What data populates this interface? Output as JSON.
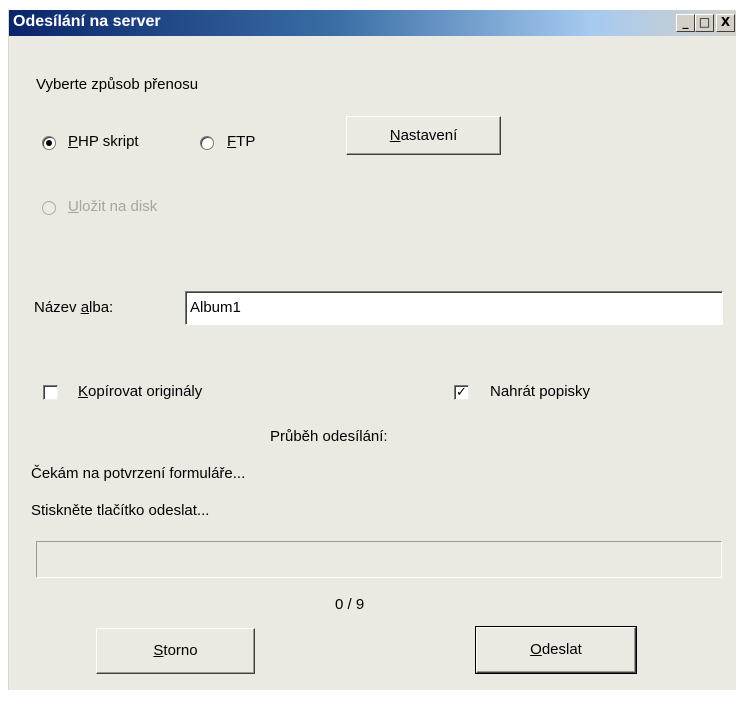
{
  "window": {
    "title": "Odesílání na server",
    "controls": {
      "minimize": "_",
      "maximize": "□",
      "close": "X"
    }
  },
  "transfer": {
    "heading": "Vyberte způsob přenosu",
    "php": {
      "mnemonic": "P",
      "rest": "HP skript",
      "checked": true
    },
    "ftp": {
      "mnemonic": "F",
      "rest": "TP",
      "checked": false
    },
    "disk": {
      "mnemonic": "U",
      "rest": "ložit na disk",
      "enabled": false
    },
    "settings_button": {
      "mnemonic": "N",
      "rest": "astavení"
    }
  },
  "album": {
    "label_pre": "Název ",
    "label_mnemonic": "a",
    "label_post": "lba:",
    "value": "Album1"
  },
  "options": {
    "copy_originals": {
      "mnemonic": "K",
      "rest": "opírovat originály",
      "checked": false
    },
    "upload_captions": {
      "label": "Nahrát popisky",
      "checked": true,
      "mark": "✓"
    }
  },
  "progress": {
    "heading": "Průběh odesílání:",
    "status_line1": "Čekám na potvrzení formuláře...",
    "status_line2": "Stiskněte tlačítko odeslat...",
    "fraction": 0,
    "counter": "0 / 9"
  },
  "buttons": {
    "cancel": {
      "mnemonic": "S",
      "rest": "torno"
    },
    "send": {
      "mnemonic": "O",
      "rest": "deslat"
    }
  }
}
